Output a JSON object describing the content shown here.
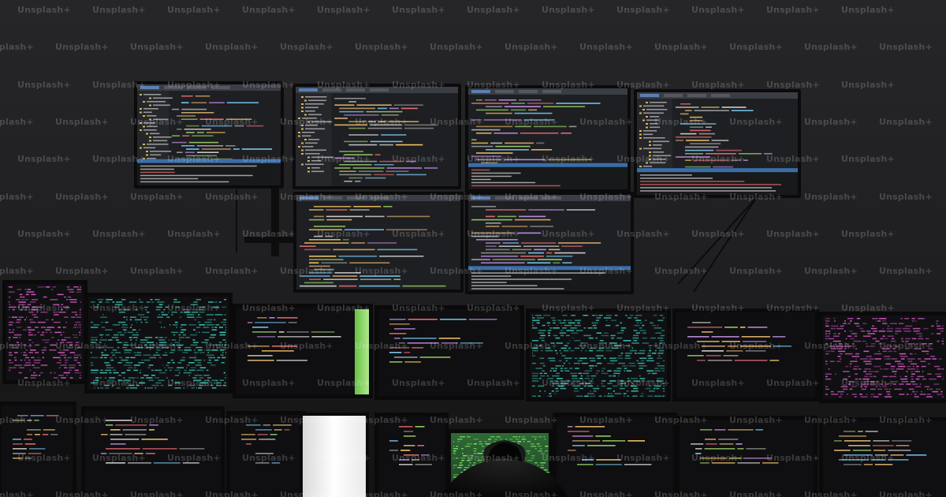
{
  "scene": {
    "description_colors": {
      "background": "#1f1f21",
      "bezel": "#0b0b0c",
      "code_bg": "#1e1f22",
      "code_bg_light": "#2b2c30",
      "teal_noise": "#3ad0c0",
      "pink_noise": "#e25bd1",
      "green_glow": "#8cf06a",
      "hood": "#0f0f10"
    },
    "icons": [
      "monitor-array",
      "hooded-figure"
    ]
  },
  "watermark": {
    "text": "Unsplash+"
  }
}
